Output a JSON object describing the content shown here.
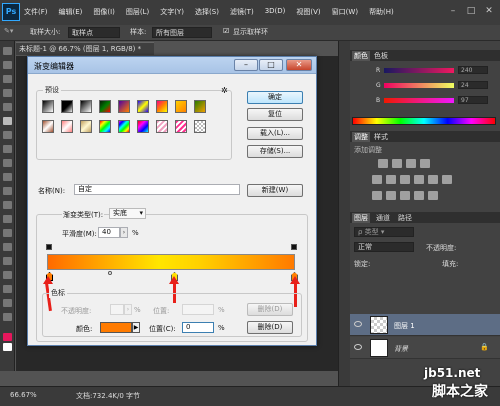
{
  "app": {
    "logo": "Ps",
    "window_controls": [
      "–",
      "□",
      "✕"
    ]
  },
  "menu": [
    "文件(F)",
    "编辑(E)",
    "图像(I)",
    "图层(L)",
    "文字(Y)",
    "选择(S)",
    "滤镜(T)",
    "3D(D)",
    "视图(V)",
    "窗口(W)",
    "帮助(H)"
  ],
  "options": {
    "sample_size_label": "取样大小:",
    "sample_size_value": "取样点",
    "sample_label": "样本:",
    "sample_value": "所有图层",
    "show_ring_label": "显示取样环"
  },
  "document": {
    "tab": "未标题-1 @ 66.7% (图层 1, RGB/8) *"
  },
  "status": {
    "zoom": "66.67%",
    "doc_info": "文档:732.4K/0 字节"
  },
  "panels": {
    "color_tabs": [
      "颜色",
      "色板"
    ],
    "color_values": [
      "240",
      "24",
      "97"
    ],
    "color_channels": [
      "R",
      "G",
      "B"
    ],
    "adjust_tabs": [
      "调整",
      "样式"
    ],
    "adjust_title": "添加调整",
    "layer_tabs": [
      "图层",
      "通道",
      "路径"
    ],
    "blend_mode": "正常",
    "opacity_label": "不透明度:",
    "lock_label": "锁定:",
    "fill_label": "填充:",
    "layers": [
      "图层 1",
      "背景"
    ]
  },
  "dialog": {
    "title": "渐变编辑器",
    "presets_label": "预设",
    "buttons": {
      "ok": "确定",
      "reset": "复位",
      "load": "载入(L)...",
      "save": "存储(S)...",
      "new": "新建(W)"
    },
    "name_label": "名称(N):",
    "name_value": "自定",
    "gradient_type_label": "渐变类型(T):",
    "gradient_type_value": "实底",
    "smoothness_label": "平滑度(M):",
    "smoothness_value": "40",
    "smoothness_unit": "%",
    "stops_label": "色标",
    "opacity_label": "不透明度:",
    "location_label_top": "位置:",
    "delete_label": "删除(D)",
    "color_label": "颜色:",
    "location_label_bottom": "位置(C):",
    "location_value": "0",
    "percent": "%",
    "stop_color": "#ff7b00"
  },
  "watermark": {
    "line1": "jb51.net",
    "line2": "脚本之家"
  }
}
